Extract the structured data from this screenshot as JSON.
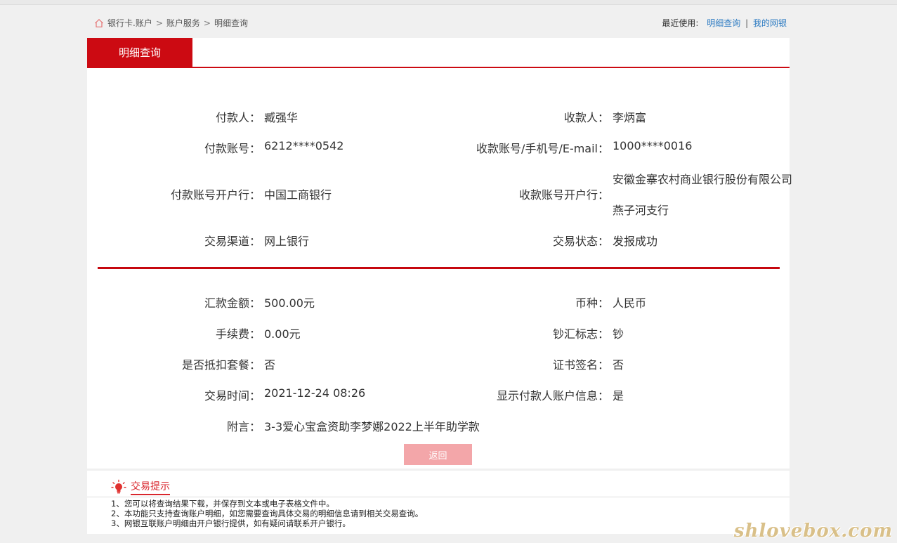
{
  "breadcrumb": {
    "items": [
      "银行卡.账户",
      "账户服务",
      "明细查询"
    ],
    "sep": ">"
  },
  "recent": {
    "label": "最近使用:",
    "links": [
      "明细查询",
      "我的网银"
    ],
    "bar": "|"
  },
  "tab": {
    "title": "明细查询"
  },
  "details": {
    "payer_label": "付款人：",
    "payer": "臧强华",
    "payee_label": "收款人：",
    "payee": "李炳富",
    "payer_acct_label": "付款账号：",
    "payer_acct": "6212****0542",
    "payee_acct_label": "收款账号/手机号/E-mail：",
    "payee_acct": "1000****0016",
    "payer_bank_label": "付款账号开户行：",
    "payer_bank": "中国工商银行",
    "payee_bank_label": "收款账号开户行：",
    "payee_bank_line1": "安徽金寨农村商业银行股份有限公司",
    "payee_bank_line2": "燕子河支行",
    "channel_label": "交易渠道：",
    "channel": "网上银行",
    "status_label": "交易状态：",
    "status": "发报成功",
    "amount_label": "汇款金额：",
    "amount": "500.00元",
    "currency_label": "币种：",
    "currency": "人民币",
    "fee_label": "手续费：",
    "fee": "0.00元",
    "cash_flag_label": "钞汇标志：",
    "cash_flag": "钞",
    "package_label": "是否抵扣套餐：",
    "package": "否",
    "cert_label": "证书签名：",
    "cert": "否",
    "time_label": "交易时间：",
    "time": "2021-12-24 08:26",
    "show_payer_label": "显示付款人账户信息：",
    "show_payer": "是",
    "note_label": "附言：",
    "note": "3-3爱心宝盒资助李梦娜2022上半年助学款"
  },
  "back_button": "返回",
  "tips": {
    "title": "交易提示",
    "lines": [
      "1、您可以将查询结果下载，并保存到文本或电子表格文件中。",
      "2、本功能只支持查询账户明细，如您需要查询具体交易的明细信息请到相关交易查询。",
      "3、网银互联账户明细由开户银行提供，如有疑问请联系开户银行。"
    ]
  },
  "watermark": "shlovebox.com",
  "colors": {
    "brand_red": "#cc0a12",
    "link_blue": "#2d7bc2",
    "button_pink": "#f3a6a9"
  }
}
